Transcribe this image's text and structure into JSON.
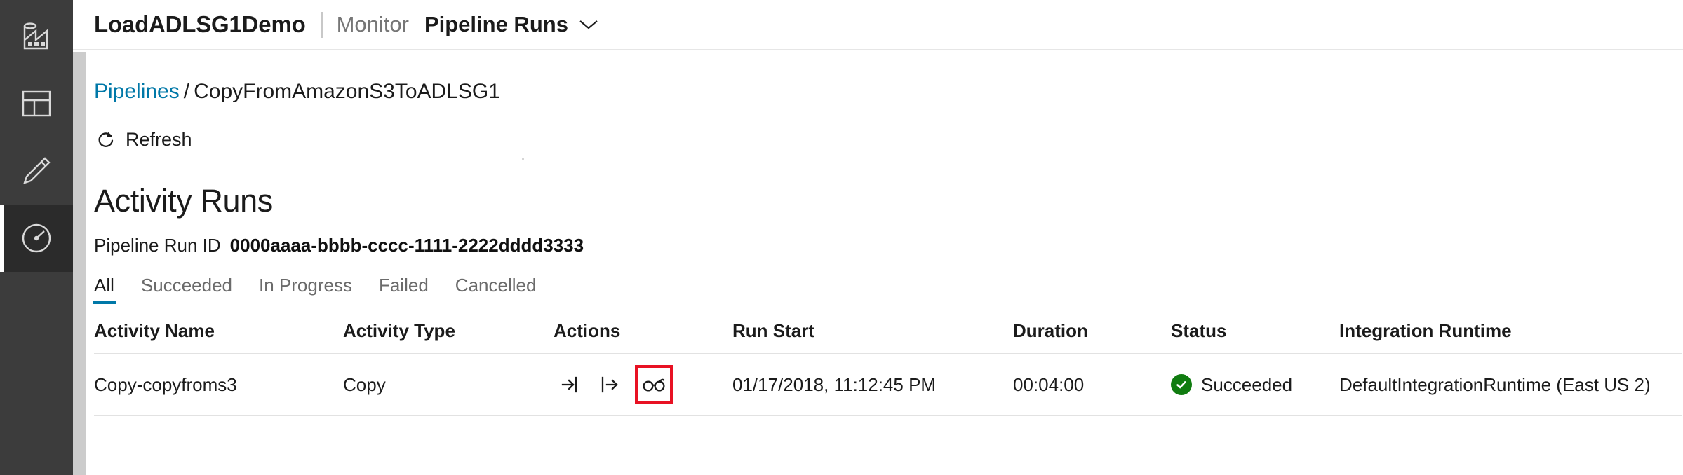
{
  "rail": {
    "items": [
      {
        "name": "factory-icon",
        "label": "Data Factory"
      },
      {
        "name": "author-overview-icon",
        "label": "Overview"
      },
      {
        "name": "pencil-icon",
        "label": "Author"
      },
      {
        "name": "monitor-gauge-icon",
        "label": "Monitor"
      }
    ],
    "active_index": 3
  },
  "header": {
    "factory_name": "LoadADLSG1Demo",
    "section": "Monitor",
    "page": "Pipeline Runs",
    "chevron_icon": "chevron-down-icon"
  },
  "breadcrumb": {
    "root": "Pipelines",
    "separator": "/",
    "current": "CopyFromAmazonS3ToADLSG1"
  },
  "toolbar": {
    "refresh_label": "Refresh",
    "refresh_icon": "refresh-icon"
  },
  "page": {
    "title": "Activity Runs",
    "run_id_label": "Pipeline Run ID",
    "run_id_value": "0000aaaa-bbbb-cccc-1111-2222dddd3333"
  },
  "tabs": {
    "selected": "All",
    "items": [
      {
        "label": "All"
      },
      {
        "label": "Succeeded"
      },
      {
        "label": "In Progress"
      },
      {
        "label": "Failed"
      },
      {
        "label": "Cancelled"
      }
    ]
  },
  "table": {
    "columns": [
      {
        "key": "activity_name",
        "label": "Activity Name"
      },
      {
        "key": "activity_type",
        "label": "Activity Type"
      },
      {
        "key": "actions",
        "label": "Actions"
      },
      {
        "key": "run_start",
        "label": "Run Start"
      },
      {
        "key": "duration",
        "label": "Duration"
      },
      {
        "key": "status",
        "label": "Status"
      },
      {
        "key": "integration_runtime",
        "label": "Integration Runtime"
      }
    ],
    "rows": [
      {
        "activity_name": "Copy-copyfroms3",
        "activity_type": "Copy",
        "actions": [
          {
            "name": "input-icon",
            "title": "Input",
            "highlighted": false
          },
          {
            "name": "output-icon",
            "title": "Output",
            "highlighted": false
          },
          {
            "name": "details-glasses-icon",
            "title": "Details",
            "highlighted": true
          }
        ],
        "run_start": "01/17/2018, 11:12:45 PM",
        "duration": "00:04:00",
        "status": "Succeeded",
        "status_icon": "success-check-icon",
        "integration_runtime": "DefaultIntegrationRuntime (East US 2)"
      }
    ]
  },
  "colors": {
    "rail_bg": "#3c3c3c",
    "rail_active_bg": "#2b2b2b",
    "link": "#0078a8",
    "accent_underline": "#0078a8",
    "success": "#107c10",
    "highlight_border": "#e81123",
    "text": "#1b1b1b",
    "muted_text": "#767676"
  }
}
